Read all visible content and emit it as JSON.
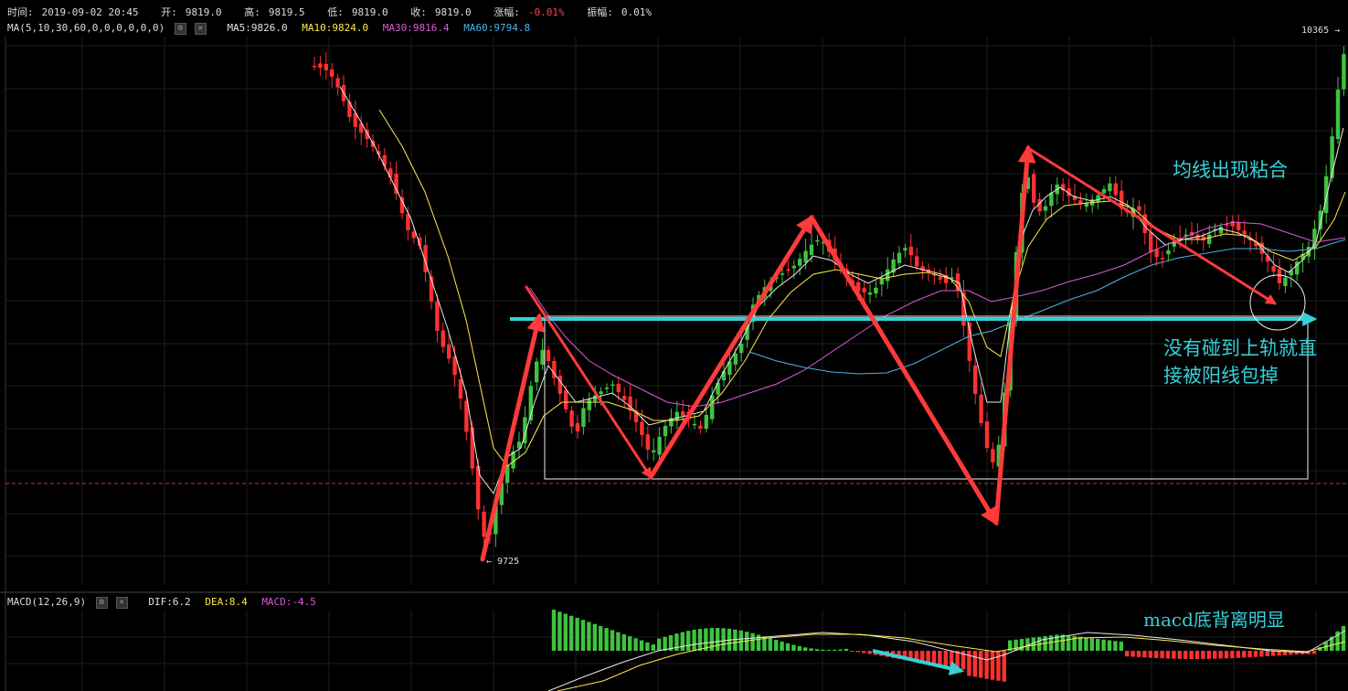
{
  "header": {
    "time_label": "时间:",
    "time": "2019-09-02 20:45",
    "open_label": "开:",
    "open": "9819.0",
    "high_label": "高:",
    "high": "9819.5",
    "low_label": "低:",
    "low": "9819.0",
    "close_label": "收:",
    "close": "9819.0",
    "change_label": "涨幅:",
    "change": "-0.01%",
    "amplitude_label": "振幅:",
    "amplitude": "0.01%"
  },
  "ma_bar": {
    "title": "MA(5,10,30,60,0,0,0,0,0,0)",
    "ma5": "MA5:9826.0",
    "ma10": "MA10:9824.0",
    "ma30": "MA30:9816.4",
    "ma60": "MA60:9794.8"
  },
  "macd_bar": {
    "title": "MACD(12,26,9)",
    "dif": "DIF:6.2",
    "dea": "DEA:8.4",
    "macd": "MACD:-4.5"
  },
  "price_labels": {
    "high": "10365",
    "low": "9725"
  },
  "annotations": {
    "ma_converge": "均线出现粘合",
    "note_line1": "没有碰到上轨就直",
    "note_line2": "接被阳线包掉",
    "macd_divergence": "macd底背离明显"
  },
  "icons": [
    "gear-icon",
    "close-icon"
  ],
  "colors": {
    "up": "#ff3030",
    "down": "#3fc33f",
    "ma5": "#e8e8e8",
    "ma10": "#ffe84a",
    "ma30": "#d95bd9",
    "ma60": "#4cb3e6",
    "annotation": "#35d0d8",
    "arrow": "#ff3a3a"
  }
}
